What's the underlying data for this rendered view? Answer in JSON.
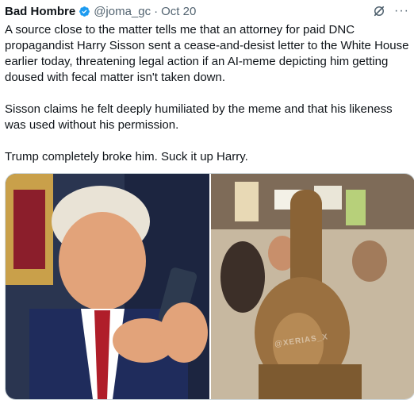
{
  "tweet": {
    "author_name": "Bad Hombre",
    "handle": "@joma_gc",
    "separator": "·",
    "date": "Oct 20",
    "paragraphs": [
      "A source close to the matter tells me that an attorney for paid DNC propagandist Harry Sisson sent a cease-and-desist letter to the White House earlier today, threatening legal action if an AI-meme depicting him getting doused with fecal matter isn't taken down.",
      "Sisson claims he felt deeply humiliated by the meme and that his likeness was used without his permission.",
      "Trump completely broke him. Suck it up Harry."
    ],
    "watermark_text": "@XERIAS_X"
  },
  "icons": {
    "verified": "verified-badge-icon",
    "grok": "grok-icon",
    "more": "more-options-icon"
  },
  "colors": {
    "verified_blue": "#1d9bf0",
    "text_primary": "#0f1419",
    "text_secondary": "#536471",
    "border": "#cfd9de"
  }
}
